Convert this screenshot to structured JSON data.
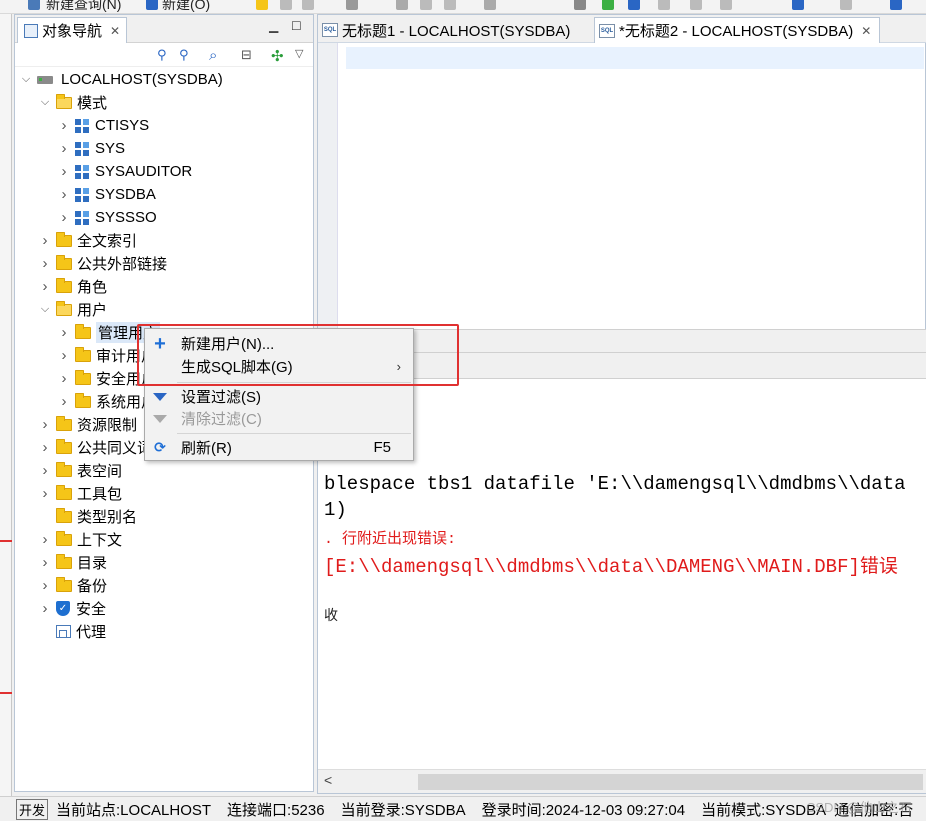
{
  "toolbar": {
    "new_query": "新建查询(N)",
    "new": "新建(O)"
  },
  "navigator": {
    "tab_label": "对象导航",
    "tree": {
      "root": "LOCALHOST(SYSDBA)",
      "items": [
        {
          "label": "模式",
          "level": 1,
          "icon": "folder-open-icon",
          "expanded": true
        },
        {
          "label": "CTISYS",
          "level": 2,
          "icon": "schema-icon",
          "expanded": false
        },
        {
          "label": "SYS",
          "level": 2,
          "icon": "schema-icon",
          "expanded": false
        },
        {
          "label": "SYSAUDITOR",
          "level": 2,
          "icon": "schema-icon",
          "expanded": false
        },
        {
          "label": "SYSDBA",
          "level": 2,
          "icon": "schema-icon",
          "expanded": false
        },
        {
          "label": "SYSSSO",
          "level": 2,
          "icon": "schema-icon",
          "expanded": false
        },
        {
          "label": "全文索引",
          "level": 1,
          "icon": "folder-icon",
          "expanded": false
        },
        {
          "label": "公共外部链接",
          "level": 1,
          "icon": "folder-icon",
          "expanded": false
        },
        {
          "label": "角色",
          "level": 1,
          "icon": "folder-icon",
          "expanded": false
        },
        {
          "label": "用户",
          "level": 1,
          "icon": "folder-open-icon",
          "expanded": true
        },
        {
          "label": "管理用户",
          "level": 2,
          "icon": "folder-icon",
          "expanded": false
        },
        {
          "label": "审计用户",
          "level": 2,
          "icon": "folder-icon",
          "expanded": false
        },
        {
          "label": "安全用户",
          "level": 2,
          "icon": "folder-icon",
          "expanded": false
        },
        {
          "label": "系统用户",
          "level": 2,
          "icon": "folder-icon",
          "expanded": false
        },
        {
          "label": "资源限制",
          "level": 1,
          "icon": "folder-icon",
          "expanded": false
        },
        {
          "label": "公共同义词",
          "level": 1,
          "icon": "folder-icon",
          "expanded": false
        },
        {
          "label": "表空间",
          "level": 1,
          "icon": "folder-icon",
          "expanded": false
        },
        {
          "label": "工具包",
          "level": 1,
          "icon": "folder-icon",
          "expanded": false
        },
        {
          "label": "类型别名",
          "level": 1,
          "icon": "folder-icon",
          "expanded": null
        },
        {
          "label": "上下文",
          "level": 1,
          "icon": "folder-icon",
          "expanded": false
        },
        {
          "label": "目录",
          "level": 1,
          "icon": "folder-icon",
          "expanded": false
        },
        {
          "label": "备份",
          "level": 1,
          "icon": "folder-icon",
          "expanded": false
        },
        {
          "label": "安全",
          "level": 1,
          "icon": "shield-icon",
          "expanded": false
        },
        {
          "label": "代理",
          "level": 1,
          "icon": "proxy-icon",
          "expanded": null
        }
      ]
    }
  },
  "editor": {
    "tabs": [
      {
        "label": "无标题1 - LOCALHOST(SYSDBA)",
        "active": false
      },
      {
        "label": "*无标题2 - LOCALHOST(SYSDBA)",
        "active": true
      }
    ],
    "result_lines": [
      "blespace tbs1 datafile 'E:\\\\damengsql\\\\dmdbms\\\\data",
      "1)",
      ". 行附近出现错误:",
      "[E:\\\\damengsql\\\\dmdbms\\\\data\\\\DAMENG\\\\MAIN.DBF]错误",
      "收"
    ],
    "scroll_left": "<"
  },
  "context_menu": {
    "items": [
      {
        "label": "新建用户(N)...",
        "icon": "plus-icon",
        "accel": "",
        "disabled": false,
        "submenu": false
      },
      {
        "label": "生成SQL脚本(G)",
        "icon": "",
        "accel": "",
        "disabled": false,
        "submenu": true
      },
      {
        "label": "设置过滤(S)",
        "icon": "filter-icon",
        "accel": "",
        "disabled": false,
        "submenu": false
      },
      {
        "label": "清除过滤(C)",
        "icon": "clear-filter-icon",
        "accel": "",
        "disabled": true,
        "submenu": false
      },
      {
        "label": "刷新(R)",
        "icon": "refresh-icon",
        "accel": "F5",
        "disabled": false,
        "submenu": false
      }
    ],
    "submenu_arrow": "›"
  },
  "statusbar": {
    "badge": "开发",
    "site": "当前站点:LOCALHOST",
    "port": "连接端口:5236",
    "login": "当前登录:SYSDBA",
    "login_time": "登录时间:2024-12-03 09:27:04",
    "mode": "当前模式:SYSDBA",
    "encrypt": "通信加密:否"
  },
  "watermark": "CSDN @他山之石",
  "colors": {
    "accent": "#1f6fd6",
    "error": "#e01b1b",
    "highlight_box": "#e03131",
    "folder": "#f5c518"
  }
}
